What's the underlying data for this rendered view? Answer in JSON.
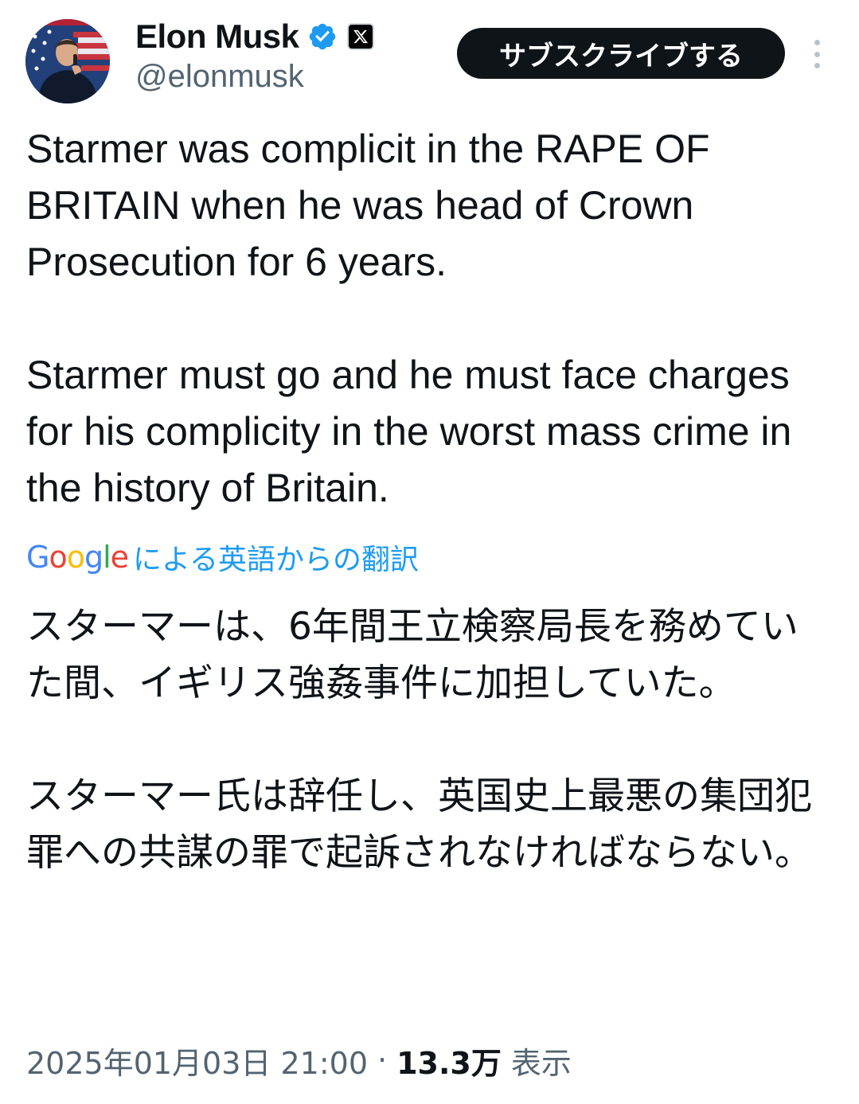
{
  "author": {
    "display_name": "Elon Musk",
    "handle": "@elonmusk",
    "verified_icon": "verified-badge-icon",
    "affiliation_icon": "x-logo-icon"
  },
  "actions": {
    "subscribe_label": "サブスクライブする",
    "more_icon": "more-vertical-icon"
  },
  "tweet": {
    "paragraphs": [
      "Starmer was complicit in the RAPE OF BRITAIN when he was head of Crown Prosecution for 6 years.",
      "Starmer must go and he must face charges for his complicity in the worst mass crime in the history of Britain."
    ]
  },
  "translation": {
    "provider": "Google",
    "label": "による英語からの翻訳",
    "paragraphs": [
      "スターマーは、6年間王立検察局長を務めていた間、イギリス強姦事件に加担していた。",
      "スターマー氏は辞任し、英国史上最悪の集団犯罪への共謀の罪で起訴されなければならない。"
    ]
  },
  "meta": {
    "timestamp": "2025年01月03日 21:00",
    "separator": "·",
    "views_count": "13.3万",
    "views_label": "表示"
  },
  "colors": {
    "text": "#0f1419",
    "secondary": "#536471",
    "link": "#1d9bf0",
    "button_bg": "#0f1419",
    "verified": "#1d9bf0"
  }
}
